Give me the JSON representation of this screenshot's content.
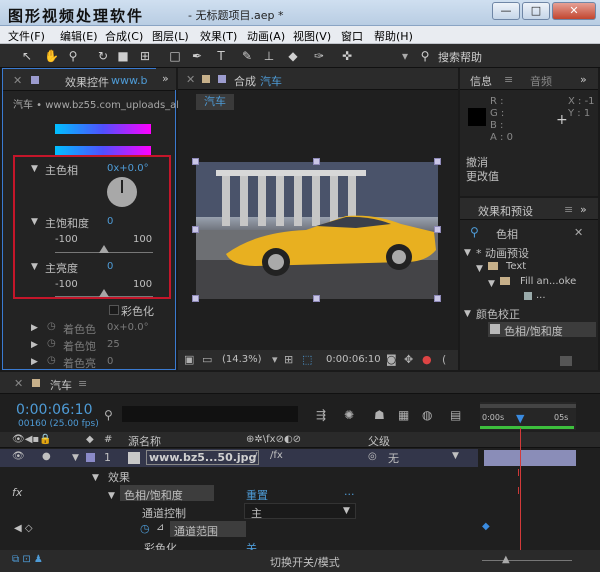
{
  "window": {
    "app_title": "图形视频处理软件",
    "doc_title": "- 无标题项目.aep *",
    "btn_min": "—",
    "btn_max": "□",
    "btn_close": "✕"
  },
  "menu": [
    "文件(F)",
    "编辑(E)",
    "合成(C)",
    "图层(L)",
    "效果(T)",
    "动画(A)",
    "视图(V)",
    "窗口",
    "帮助(H)"
  ],
  "toolbar": {
    "search_label": "搜索帮助"
  },
  "effects_panel": {
    "tab_label": "效果控件",
    "tab_link": "www.b",
    "layer_path": "汽车 • www.bz55.com_uploads_alli",
    "hue_label": "主色相",
    "hue_value": "0x+0.0°",
    "sat_label": "主饱和度",
    "sat_value": "0",
    "sat_min": "-100",
    "sat_max": "100",
    "sat_level": 0,
    "light_label": "主亮度",
    "light_value": "0",
    "light_min": "-100",
    "light_max": "100",
    "light_level": 0,
    "colorize_label": "彩色化",
    "colorize_hue_label": "着色色",
    "colorize_hue_value": "0x+0.0°",
    "colorize_sat_label": "着色饱",
    "colorize_sat_value": "25",
    "colorize_light_label": "着色亮",
    "colorize_light_value": "0",
    "accent_red": "#c4162a"
  },
  "comp_panel": {
    "tab_label": "合成",
    "tab_name": "汽车",
    "layer_tag": "汽车",
    "zoom": "(14.3%)",
    "timecode": "0:00:06:10"
  },
  "info_panel": {
    "tab_info": "信息",
    "tab_audio": "音频",
    "r": "R :",
    "g": "G :",
    "b": "B :",
    "a": "A : 0",
    "x": "X : -1",
    "y": "Y : 1",
    "undo": "撤消",
    "change": "更改值"
  },
  "presets_panel": {
    "tab_label": "效果和预设",
    "search_value": "色相",
    "tree": [
      "* 动画预设",
      "Text",
      "Fill an...oke",
      "...",
      "颜色校正",
      "色相/饱和度"
    ]
  },
  "timeline": {
    "tab_label": "汽车",
    "timecode": "0:00:06:10",
    "frame_info": "00160 (25.00 fps)",
    "col_source": "源名称",
    "col_parent": "父级",
    "layer_num": "1",
    "layer_name": "www.bz5...50.jpg",
    "layer_parent": "无",
    "effects_label": "效果",
    "effect_name": "色相/饱和度",
    "effect_reset": "重置",
    "effect_more": "...",
    "channel_label": "通道控制",
    "channel_value": "主",
    "range_label": "通道范围",
    "colorize_label": "彩色化",
    "colorize_value": "关",
    "footer_label": "切换开关/模式",
    "ruler_start": "0:00s",
    "ruler_end": "05s",
    "playhead_color": "#d23a3a"
  }
}
